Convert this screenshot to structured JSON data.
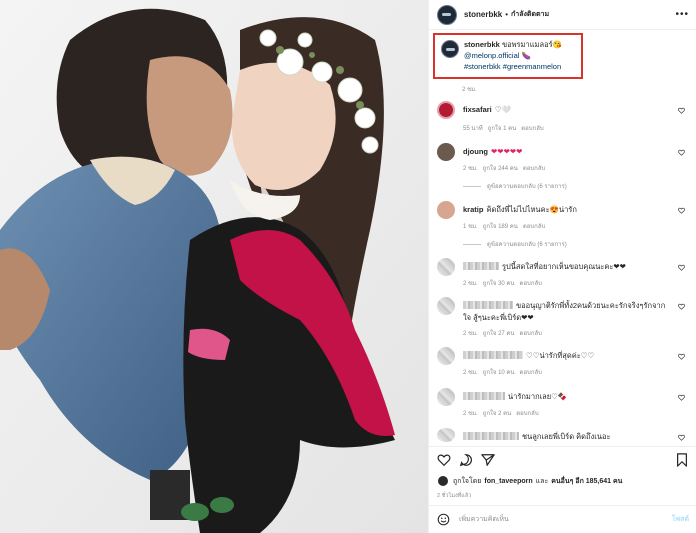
{
  "header": {
    "username": "stonerbkk",
    "separator": "•",
    "follow_label": "กำลังติดตาม",
    "more": "•••"
  },
  "caption": {
    "username": "stonerbkk",
    "text": "ขอพรมาแมลอร์😘",
    "mention": "@melonp.official",
    "emoji": "🍆",
    "hashtags": "#stonerbkk #greenmanmelon",
    "time": "2 ชม."
  },
  "comments": [
    {
      "username": "fixsafari",
      "text": "♡🤍",
      "meta": [
        "55 นาที",
        "ถูกใจ 1 คน",
        "ตอบกลับ"
      ],
      "replies": ""
    },
    {
      "username": "djoung",
      "text": "❤❤❤❤❤",
      "meta": [
        "2 ชม.",
        "ถูกใจ 244 คน",
        "ตอบกลับ"
      ],
      "replies": "ดูข้อความตอบกลับ (6 รายการ)"
    },
    {
      "username": "kratip",
      "text": "คิดถึงพี่ไม่ไปไหนคะ😍น่ารัก",
      "meta": [
        "1 ชม.",
        "ถูกใจ 189 คน",
        "ตอบกลับ"
      ],
      "replies": "ดูข้อความตอบกลับ (6 รายการ)"
    },
    {
      "username": "",
      "text": "รูปนี้สดใสที่อยากเห็นขอบคุณนะคะ❤❤",
      "meta": [
        "2 ชม.",
        "ถูกใจ 30 คน",
        "ตอบกลับ"
      ],
      "replies": ""
    },
    {
      "username": "",
      "text": "ขออนุญาติรักพี่ทั้ง2คนด้วยนะคะรักจริงๆรักจากใจ สู้ๆนะคะพี่เบิร์ด❤❤",
      "meta": [
        "2 ชม.",
        "ถูกใจ 27 คน",
        "ตอบกลับ"
      ],
      "replies": ""
    },
    {
      "username": "",
      "text": "♡♡น่ารักที่สุดค่ะ♡♡",
      "meta": [
        "2 ชม.",
        "ถูกใจ 10 คน",
        "ตอบกลับ"
      ],
      "replies": ""
    },
    {
      "username": "",
      "text": "น่ารักมากเลย♡🍫",
      "meta": [
        "2 ชม.",
        "ถูกใจ 2 คน",
        "ตอบกลับ"
      ],
      "replies": ""
    },
    {
      "username": "",
      "text": "ชนลูกเลยพี่เบิร์ด คิดถึงเนอะ",
      "meta": [],
      "replies": ""
    }
  ],
  "likes": {
    "prefix": "ถูกใจโดย",
    "user": "fon_taveeporn",
    "middle": "และ",
    "others": "คนอื่นๆ อีก 185,641 คน"
  },
  "post_date": "2 ชั่วโมงที่แล้ว",
  "add_comment": {
    "placeholder": "เพิ่มความคิดเห็น",
    "post_label": "โพสต์"
  },
  "colors": {
    "highlight_box": "#d9342b",
    "heart": "#e0245e",
    "link": "#00376b",
    "post_btn": "#b2dffc"
  }
}
